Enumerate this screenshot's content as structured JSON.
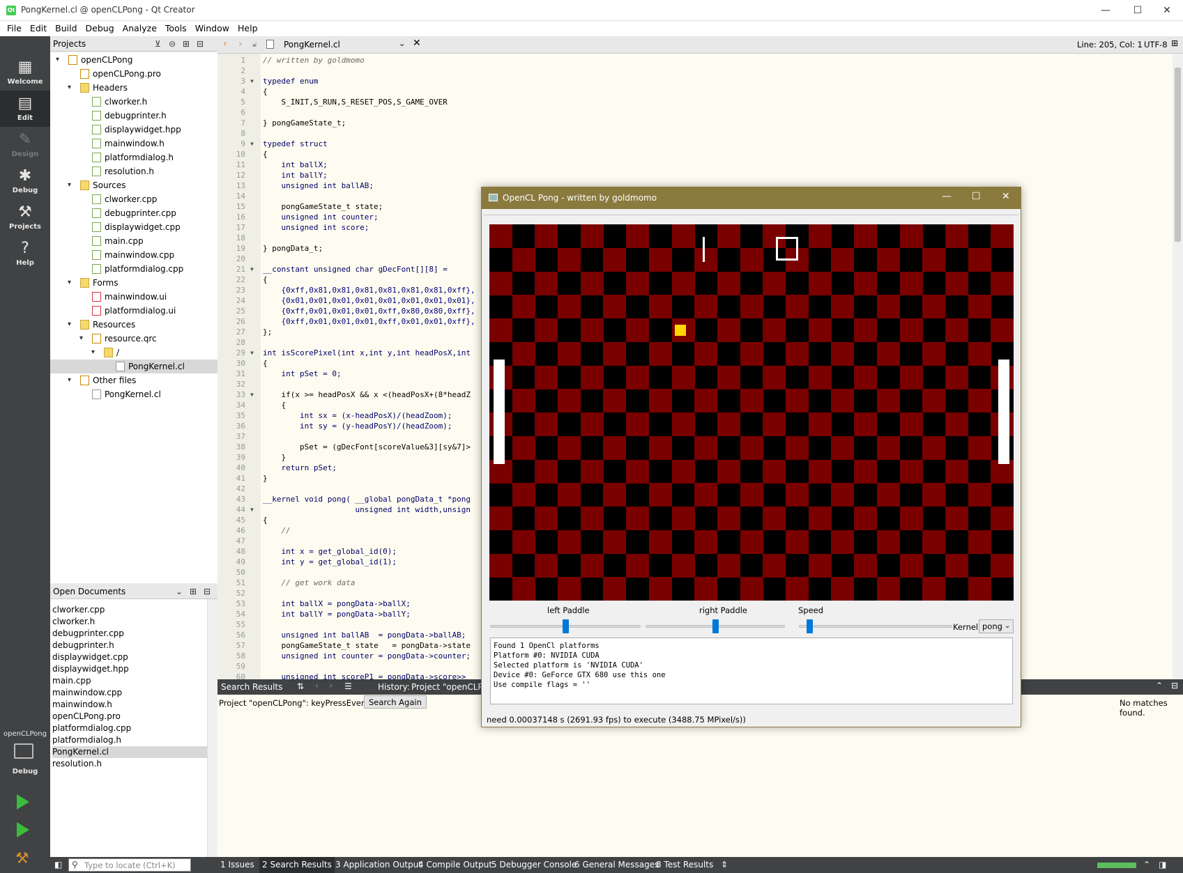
{
  "window": {
    "title": "PongKernel.cl @ openCLPong - Qt Creator",
    "minimize": "—",
    "maximize": "☐",
    "close": "✕"
  },
  "menu": [
    "File",
    "Edit",
    "Build",
    "Debug",
    "Analyze",
    "Tools",
    "Window",
    "Help"
  ],
  "modes": {
    "welcome": "Welcome",
    "edit": "Edit",
    "design": "Design",
    "debug": "Debug",
    "projects": "Projects",
    "help": "Help",
    "target_project": "openCLPong",
    "target_mode": "Debug"
  },
  "projects_pane": {
    "title": "Projects",
    "tree": [
      {
        "label": "openCLPong",
        "indent": 0,
        "arrow": "▾",
        "icon": "proj"
      },
      {
        "label": "openCLPong.pro",
        "indent": 1,
        "arrow": "",
        "icon": "proj"
      },
      {
        "label": "Headers",
        "indent": 1,
        "arrow": "▾",
        "icon": "folder"
      },
      {
        "label": "clworker.h",
        "indent": 2,
        "arrow": "",
        "icon": "hdr"
      },
      {
        "label": "debugprinter.h",
        "indent": 2,
        "arrow": "",
        "icon": "hdr"
      },
      {
        "label": "displaywidget.hpp",
        "indent": 2,
        "arrow": "",
        "icon": "hdr"
      },
      {
        "label": "mainwindow.h",
        "indent": 2,
        "arrow": "",
        "icon": "hdr"
      },
      {
        "label": "platformdialog.h",
        "indent": 2,
        "arrow": "",
        "icon": "hdr"
      },
      {
        "label": "resolution.h",
        "indent": 2,
        "arrow": "",
        "icon": "hdr"
      },
      {
        "label": "Sources",
        "indent": 1,
        "arrow": "▾",
        "icon": "folder"
      },
      {
        "label": "clworker.cpp",
        "indent": 2,
        "arrow": "",
        "icon": "src"
      },
      {
        "label": "debugprinter.cpp",
        "indent": 2,
        "arrow": "",
        "icon": "src"
      },
      {
        "label": "displaywidget.cpp",
        "indent": 2,
        "arrow": "",
        "icon": "src"
      },
      {
        "label": "main.cpp",
        "indent": 2,
        "arrow": "",
        "icon": "src"
      },
      {
        "label": "mainwindow.cpp",
        "indent": 2,
        "arrow": "",
        "icon": "src"
      },
      {
        "label": "platformdialog.cpp",
        "indent": 2,
        "arrow": "",
        "icon": "src"
      },
      {
        "label": "Forms",
        "indent": 1,
        "arrow": "▾",
        "icon": "folder"
      },
      {
        "label": "mainwindow.ui",
        "indent": 2,
        "arrow": "",
        "icon": "ui"
      },
      {
        "label": "platformdialog.ui",
        "indent": 2,
        "arrow": "",
        "icon": "ui"
      },
      {
        "label": "Resources",
        "indent": 1,
        "arrow": "▾",
        "icon": "folder"
      },
      {
        "label": "resource.qrc",
        "indent": 2,
        "arrow": "▾",
        "icon": "proj"
      },
      {
        "label": "/",
        "indent": 3,
        "arrow": "▾",
        "icon": "folder"
      },
      {
        "label": "PongKernel.cl",
        "indent": 4,
        "arrow": "",
        "icon": "file",
        "selected": true
      },
      {
        "label": "Other files",
        "indent": 1,
        "arrow": "▾",
        "icon": "proj"
      },
      {
        "label": "PongKernel.cl",
        "indent": 2,
        "arrow": "",
        "icon": "file"
      }
    ]
  },
  "open_documents": {
    "title": "Open Documents",
    "items": [
      "clworker.cpp",
      "clworker.h",
      "debugprinter.cpp",
      "debugprinter.h",
      "displaywidget.cpp",
      "displaywidget.hpp",
      "main.cpp",
      "mainwindow.cpp",
      "mainwindow.h",
      "openCLPong.pro",
      "platformdialog.cpp",
      "platformdialog.h",
      "PongKernel.cl",
      "resolution.h"
    ],
    "selected_index": 12
  },
  "editor": {
    "file_tab": "PongKernel.cl",
    "cursor": "Line: 205, Col: 1",
    "encoding": "UTF-8",
    "lines": [
      "// written by goldmomo",
      "",
      "typedef enum",
      "{",
      "    S_INIT,S_RUN,S_RESET_POS,S_GAME_OVER",
      "",
      "} pongGameState_t;",
      "",
      "typedef struct",
      "{",
      "    int ballX;",
      "    int ballY;",
      "    unsigned int ballAB;",
      "",
      "    pongGameState_t state;",
      "    unsigned int counter;",
      "    unsigned int score;",
      "",
      "} pongData_t;",
      "",
      "__constant unsigned char gDecFont[][8] =",
      "{",
      "    {0xff,0x81,0x81,0x81,0x81,0x81,0x81,0xff},",
      "    {0x01,0x01,0x01,0x01,0x01,0x01,0x01,0x01},",
      "    {0xff,0x01,0x01,0x01,0xff,0x80,0x80,0xff},",
      "    {0xff,0x01,0x01,0x01,0xff,0x01,0x01,0xff},",
      "};",
      "",
      "int isScorePixel(int x,int y,int headPosX,int",
      "{",
      "    int pSet = 0;",
      "",
      "    if(x >= headPosX && x <(headPosX+(8*headZ",
      "    {",
      "        int sx = (x-headPosX)/(headZoom);",
      "        int sy = (y-headPosY)/(headZoom);",
      "",
      "        pSet = (gDecFont[scoreValue&3][sy&7]>",
      "    }",
      "    return pSet;",
      "}",
      "",
      "__kernel void pong( __global pongData_t *pong",
      "                    unsigned int width,unsign",
      "{",
      "    //",
      "",
      "    int x = get_global_id(0);",
      "    int y = get_global_id(1);",
      "",
      "    // get work data",
      "",
      "    int ballX = pongData->ballX;",
      "    int ballY = pongData->ballY;",
      "",
      "    unsigned int ballAB  = pongData->ballAB;",
      "    pongGameState_t state   = pongData->state",
      "    unsigned int counter = pongData->counter;",
      "",
      "    unsigned int scoreP1 = pongData->score>>"
    ],
    "fold_lines": [
      3,
      9,
      21,
      29,
      33,
      44
    ]
  },
  "search": {
    "title": "Search Results",
    "history_label": "History:",
    "history_value": "Project \"openCLPong",
    "result_text": "Project \"openCLPong\":  keyPressEvent",
    "search_again": "Search Again",
    "no_matches": "No matches found."
  },
  "status": {
    "locator_placeholder": "Type to locate (Ctrl+K)",
    "tabs": [
      "1  Issues",
      "2  Search Results",
      "3  Application Output",
      "4  Compile Output",
      "5  Debugger Console",
      "6  General Messages",
      "8  Test Results"
    ]
  },
  "pong_window": {
    "title": "OpenCL Pong - written by goldmomo",
    "sliders": {
      "left_label": "left Paddle",
      "left_value": 0.5,
      "right_label": "right Paddle",
      "right_value": 0.5,
      "speed_label": "Speed",
      "speed_value": 0.07
    },
    "kernel_label": "Kernel",
    "kernel_value": "pong",
    "console": [
      "Found 1 OpenCl platforms",
      "Platform #0: NVIDIA CUDA",
      "Selected platform is 'NVIDIA CUDA'",
      "Device #0: GeForce GTX 680 use this one",
      "Use compile flags = ''"
    ],
    "status": "need 0.00037148 s (2691.93 fps) to execute (3488.75 MPixel/s))",
    "colors": {
      "checker_dark": "#7a0000",
      "checker_light": "#000000",
      "ball": "#ffd700",
      "paddle": "#ffffff"
    }
  }
}
